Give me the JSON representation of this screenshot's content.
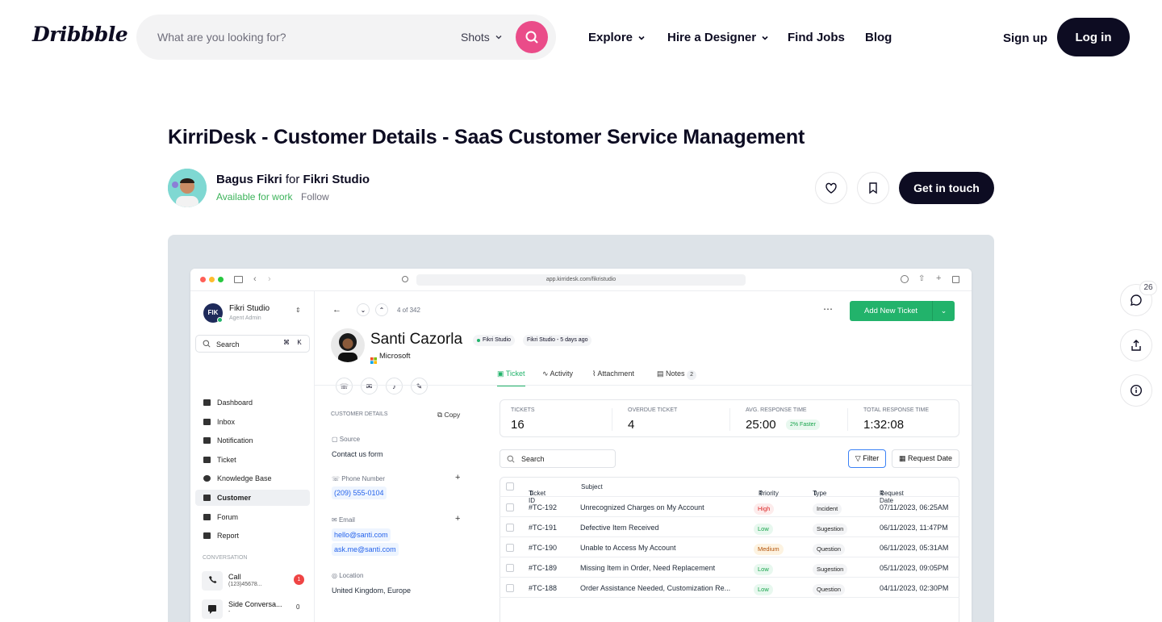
{
  "header": {
    "logo": "Dribbble",
    "search_placeholder": "What are you looking for?",
    "search_scope": "Shots",
    "nav": [
      "Explore",
      "Hire a Designer",
      "Find Jobs",
      "Blog"
    ],
    "signup": "Sign up",
    "login": "Log in"
  },
  "shot": {
    "title": "KirriDesk - Customer Details - SaaS Customer Service Management",
    "author": "Bagus Fikri",
    "for_word": "for",
    "team": "Fikri Studio",
    "availability": "Available for work",
    "follow": "Follow",
    "cta": "Get in touch",
    "comment_count": "26"
  },
  "app": {
    "url": "app.kirridesk.com/fikristudio",
    "workspace": "Fikri Studio",
    "workspace_role": "Agent Admin",
    "workspace_logo": "FIK",
    "search": "Search",
    "shortcut": [
      "⌘",
      "K"
    ],
    "sidebar": [
      "Dashboard",
      "Inbox",
      "Notification",
      "Ticket",
      "Knowledge Base",
      "Customer",
      "Forum",
      "Report"
    ],
    "conversation_header": "CONVERSATION",
    "conversations": [
      {
        "name": "Call",
        "sub": "(123)45678...",
        "badge": "1"
      },
      {
        "name": "Side Conversa...",
        "sub": "-",
        "badge": "0"
      }
    ],
    "pager": "4 of 342",
    "add_ticket": "Add New Ticket",
    "customer_name": "Santi Cazorla",
    "tag_studio": "Fikri Studio",
    "tag_meta": "Fikri Studio - 5 days ago",
    "company": "Microsoft",
    "tabs": [
      "Ticket",
      "Activity",
      "Attachment",
      "Notes"
    ],
    "notes_count": "2",
    "details_header": "CUSTOMER DETAILS",
    "copy": "Copy",
    "source_label": "Source",
    "source_value": "Contact us form",
    "phone_label": "Phone Number",
    "phone_value": "(209) 555-0104",
    "email_label": "Email",
    "email_1": "hello@santi.com",
    "email_2": "ask.me@santi.com",
    "location_label": "Location",
    "location_value": "United Kingdom, Europe",
    "stats": [
      {
        "label": "TICKETS",
        "value": "16"
      },
      {
        "label": "OVERDUE TICKET",
        "value": "4"
      },
      {
        "label": "AVG. RESPONSE TIME",
        "value": "25:00",
        "badge": "2% Faster"
      },
      {
        "label": "TOTAL RESPONSE TIME",
        "value": "1:32:08"
      }
    ],
    "table_search": "Search",
    "filter": "Filter",
    "request_date_btn": "Request Date",
    "columns": [
      "Ticket ID",
      "Subject",
      "Priority",
      "Type",
      "Request Date"
    ],
    "rows": [
      {
        "id": "#TC-192",
        "subject": "Unrecognized Charges on My Account",
        "priority": "High",
        "type": "Incident",
        "date": "07/11/2023, 06:25AM"
      },
      {
        "id": "#TC-191",
        "subject": "Defective Item Received",
        "priority": "Low",
        "type": "Sugestion",
        "date": "06/11/2023, 11:47PM"
      },
      {
        "id": "#TC-190",
        "subject": "Unable to Access My Account",
        "priority": "Medium",
        "type": "Question",
        "date": "06/11/2023, 05:31AM"
      },
      {
        "id": "#TC-189",
        "subject": "Missing Item in Order, Need Replacement",
        "priority": "Low",
        "type": "Sugestion",
        "date": "05/11/2023, 09:05PM"
      },
      {
        "id": "#TC-188",
        "subject": "Order Assistance Needed, Customization Re...",
        "priority": "Low",
        "type": "Question",
        "date": "04/11/2023, 02:30PM"
      }
    ]
  },
  "colors": {
    "brand_pink": "#ea4c89",
    "dark": "#0d0c22",
    "green": "#22b36b",
    "available": "#3cb35a"
  }
}
